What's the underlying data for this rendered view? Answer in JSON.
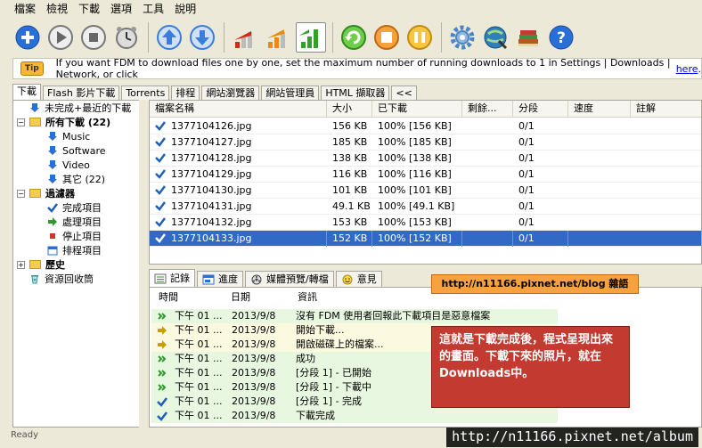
{
  "menu": [
    "檔案",
    "檢視",
    "下載",
    "選項",
    "工具",
    "說明"
  ],
  "toolbar_buttons": [
    {
      "name": "add-icon",
      "color": "#2a6fd6"
    },
    {
      "name": "play-icon",
      "color": "#777777"
    },
    {
      "name": "stop-icon",
      "color": "#777777"
    },
    {
      "name": "scheduler-clock-icon",
      "color": "#888888"
    },
    {
      "name": "move-up-icon",
      "color": "#3b7ddb"
    },
    {
      "name": "move-down-icon",
      "color": "#3b7ddb"
    },
    {
      "name": "speed-low-icon",
      "color": "#d12a1a"
    },
    {
      "name": "speed-medium-icon",
      "color": "#e98a12"
    },
    {
      "name": "speed-high-icon",
      "color": "#33a02c"
    },
    {
      "name": "refresh-green-icon",
      "color": "#33a02c"
    },
    {
      "name": "refresh-orange-icon",
      "color": "#f08a12"
    },
    {
      "name": "pause-all-icon",
      "color": "#f0b020"
    },
    {
      "name": "settings-gear-icon",
      "color": "#4a86c5"
    },
    {
      "name": "site-explorer-icon",
      "color": "#2f7fb8"
    },
    {
      "name": "books-icon",
      "color": "#b35a20"
    },
    {
      "name": "help-icon",
      "color": "#2a6fd6"
    }
  ],
  "tip": {
    "label": "Tip",
    "text": "If you want FDM to download files one by one, set the maximum number of running downloads to 1 in Settings | Downloads | Network, or click ",
    "link": "here",
    "end": "."
  },
  "tabs": [
    "下載",
    "Flash 影片下載",
    "Torrents",
    "排程",
    "網站瀏覽器",
    "網站管理員",
    "HTML 擷取器",
    "<<"
  ],
  "tree": {
    "unfinished": "未完成+最近的下載",
    "all": "所有下載 (22)",
    "music": "Music",
    "software": "Software",
    "video": "Video",
    "other": "其它 (22)",
    "filters": "過濾器",
    "completed": "完成項目",
    "processing": "處理項目",
    "stopped": "停止項目",
    "scheduled": "排程項目",
    "history": "歷史",
    "recycle": "資源回收筒"
  },
  "list": {
    "headers": [
      "檔案名稱",
      "大小",
      "已下載",
      "剩餘...",
      "分段",
      "速度",
      "註解"
    ],
    "rows": [
      {
        "name": "1377104126.jpg",
        "size": "156 KB",
        "done": "100% [156 KB]",
        "remain": "",
        "seg": "0/1"
      },
      {
        "name": "1377104127.jpg",
        "size": "185 KB",
        "done": "100% [185 KB]",
        "remain": "",
        "seg": "0/1"
      },
      {
        "name": "1377104128.jpg",
        "size": "138 KB",
        "done": "100% [138 KB]",
        "remain": "",
        "seg": "0/1"
      },
      {
        "name": "1377104129.jpg",
        "size": "116 KB",
        "done": "100% [116 KB]",
        "remain": "",
        "seg": "0/1"
      },
      {
        "name": "1377104130.jpg",
        "size": "101 KB",
        "done": "100% [101 KB]",
        "remain": "",
        "seg": "0/1"
      },
      {
        "name": "1377104131.jpg",
        "size": "49.1 KB",
        "done": "100% [49.1 KB]",
        "remain": "",
        "seg": "0/1"
      },
      {
        "name": "1377104132.jpg",
        "size": "153 KB",
        "done": "100% [153 KB]",
        "remain": "",
        "seg": "0/1"
      },
      {
        "name": "1377104133.jpg",
        "size": "152 KB",
        "done": "100% [152 KB]",
        "remain": "",
        "seg": "0/1"
      }
    ]
  },
  "bottom_tabs": [
    "記錄",
    "進度",
    "媒體預覽/轉檔",
    "意見"
  ],
  "log": {
    "headers": [
      "時間",
      "日期",
      "資訊"
    ],
    "rows": [
      {
        "icon": "double-arrow",
        "color": "#2e9a2e",
        "bg": "#e8f7e0",
        "time": "下午 01 ...",
        "date": "2013/9/8",
        "info": "沒有 FDM 使用者回報此下載項目是惡意檔案"
      },
      {
        "icon": "arrow",
        "color": "#c8a000",
        "bg": "#fbfae0",
        "time": "下午 01 ...",
        "date": "2013/9/8",
        "info": "開始下載..."
      },
      {
        "icon": "arrow",
        "color": "#c8a000",
        "bg": "#fbfae0",
        "time": "下午 01 ...",
        "date": "2013/9/8",
        "info": "開啟磁碟上的檔案..."
      },
      {
        "icon": "double-arrow",
        "color": "#2e9a2e",
        "bg": "#e8f7e0",
        "time": "下午 01 ...",
        "date": "2013/9/8",
        "info": "成功"
      },
      {
        "icon": "double-arrow",
        "color": "#2e9a2e",
        "bg": "#e8f7e0",
        "time": "下午 01 ...",
        "date": "2013/9/8",
        "info": "[分段 1] - 已開始"
      },
      {
        "icon": "double-arrow",
        "color": "#2e9a2e",
        "bg": "#e8f7e0",
        "time": "下午 01 ...",
        "date": "2013/9/8",
        "info": "[分段 1] - 下載中"
      },
      {
        "icon": "check",
        "color": "#1f5fb8",
        "bg": "#e8f7e0",
        "time": "下午 01 ...",
        "date": "2013/9/8",
        "info": "[分段 1] - 完成"
      },
      {
        "icon": "check",
        "color": "#1f5fb8",
        "bg": "#e8f7e0",
        "time": "下午 01 ...",
        "date": "2013/9/8",
        "info": "下載完成"
      }
    ]
  },
  "overlay": {
    "url": "http://n11166.pixnet.net/blog 雜語",
    "note": "這就是下載完成後，程式呈現出來的畫面。下載下來的照片，就在Downloads中。"
  },
  "status": "Ready",
  "watermark": "http://n11166.pixnet.net/album"
}
